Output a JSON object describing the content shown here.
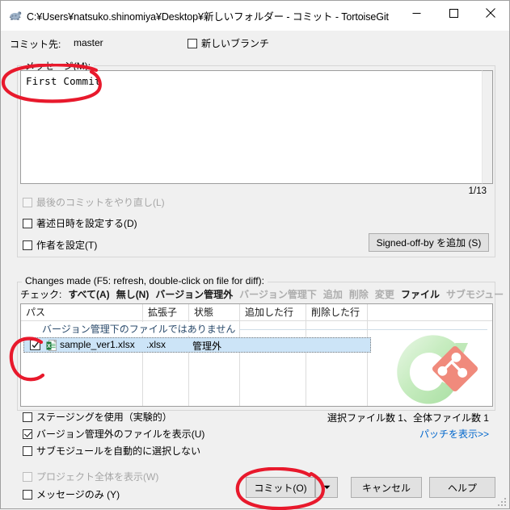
{
  "window": {
    "title": "C:¥Users¥natsuko.shinomiya¥Desktop¥新しいフォルダー - コミット - TortoiseGit",
    "icon": "tortoise-icon",
    "minimize": "minimize-icon",
    "maximize": "maximize-icon",
    "close": "close-icon"
  },
  "commit_to": {
    "label": "コミット先:",
    "branch": "master",
    "new_branch_label": "新しいブランチ",
    "new_branch_checked": false
  },
  "message": {
    "group_label": "メッセージ(M):",
    "text": "First Commit",
    "counter": "1/13"
  },
  "options": {
    "amend": {
      "label": "最後のコミットをやり直し(L)",
      "checked": false,
      "disabled": true
    },
    "set_author_date": {
      "label": "著述日時を設定する(D)",
      "checked": false,
      "disabled": false
    },
    "set_author": {
      "label": "作者を設定(T)",
      "checked": false,
      "disabled": false
    },
    "signed_off_button": "Signed-off-by を追加 (S)"
  },
  "changes": {
    "group_label": "Changes made (F5: refresh, double-click on file for diff):",
    "filter_prefix": "チェック:",
    "filters": [
      {
        "label": "すべて(A)",
        "enabled": true
      },
      {
        "label": "無し(N)",
        "enabled": true
      },
      {
        "label": "バージョン管理外",
        "enabled": true
      },
      {
        "label": "バージョン管理下",
        "enabled": false
      },
      {
        "label": "追加",
        "enabled": false
      },
      {
        "label": "削除",
        "enabled": false
      },
      {
        "label": "変更",
        "enabled": false
      },
      {
        "label": "ファイル",
        "enabled": true
      },
      {
        "label": "サブモジュー",
        "enabled": false
      }
    ],
    "columns": [
      {
        "label": "パス"
      },
      {
        "label": "拡張子"
      },
      {
        "label": "状態"
      },
      {
        "label": "追加した行"
      },
      {
        "label": "削除した行"
      },
      {
        "label": ""
      }
    ],
    "group_header": "バージョン管理下のファイルではありません",
    "rows": [
      {
        "checked": true,
        "icon": "excel-file-icon",
        "path": "sample_ver1.xlsx",
        "ext": ".xlsx",
        "state": "管理外",
        "lines_added": "",
        "lines_removed": "",
        "selected": true
      }
    ],
    "watermark": "tortoisegit-logo-watermark",
    "count_text": "選択ファイル数 1、全体ファイル数 1",
    "patch_link": "パッチを表示>>"
  },
  "bottom_options": [
    {
      "label": "ステージングを使用（実験的）",
      "checked": false,
      "disabled": false
    },
    {
      "label": "バージョン管理外のファイルを表示(U)",
      "checked": true,
      "disabled": false
    },
    {
      "label": "サブモジュールを自動的に選択しない",
      "checked": false,
      "disabled": false
    }
  ],
  "footer_options": [
    {
      "label": "プロジェクト全体を表示(W)",
      "checked": false,
      "disabled": true
    },
    {
      "label": "メッセージのみ (Y)",
      "checked": false,
      "disabled": false
    }
  ],
  "buttons": {
    "commit": "コミット(O)",
    "commit_dropdown": "chevron-down-icon",
    "cancel": "キャンセル",
    "help": "ヘルプ"
  },
  "annotations": {
    "color": "#e8192c",
    "marks": [
      "ellipse-around-commit-message",
      "ellipse-around-file-checkbox",
      "ellipse-around-commit-button"
    ]
  }
}
